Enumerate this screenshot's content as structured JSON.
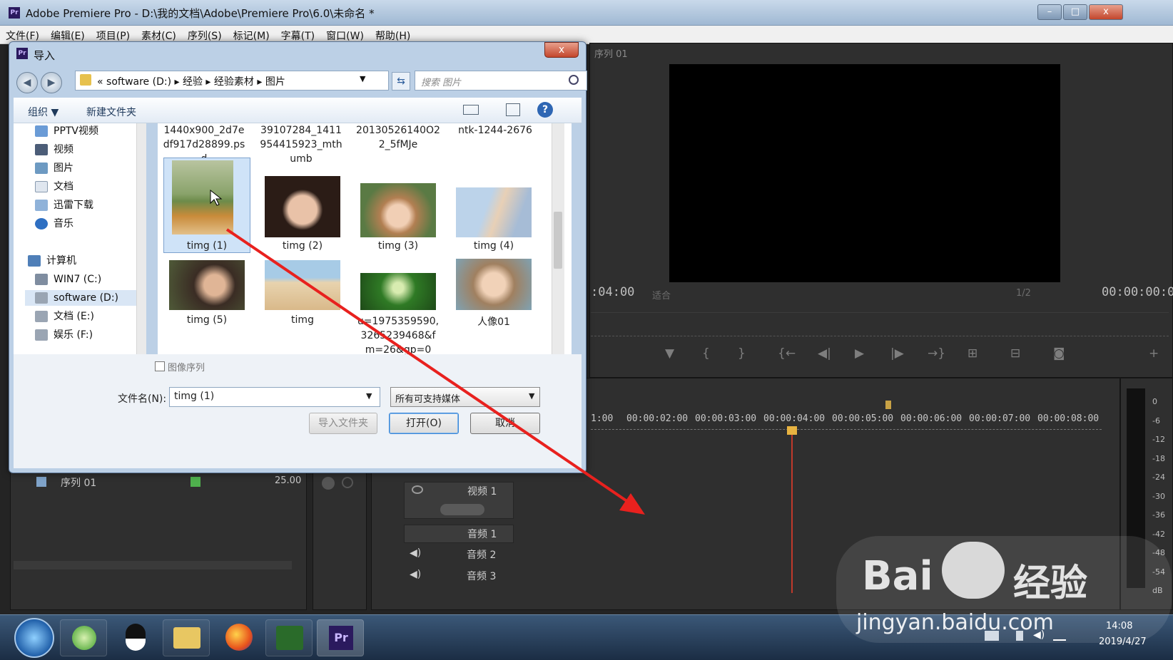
{
  "app": {
    "title": "Adobe Premiere Pro - D:\\我的文档\\Adobe\\Premiere Pro\\6.0\\未命名 *",
    "logo": "Pr",
    "controls": {
      "minimize": "–",
      "maximize": "□",
      "close": "x"
    }
  },
  "menu": [
    "文件(F)",
    "编辑(E)",
    "项目(P)",
    "素材(C)",
    "序列(S)",
    "标记(M)",
    "字幕(T)",
    "窗口(W)",
    "帮助(H)"
  ],
  "monitor": {
    "tab": "序列 01",
    "tc_left": ":04:00",
    "fit_label": "适合",
    "ratio": "1/2",
    "tc_right": "00:00:00:00",
    "controls": [
      "▼",
      "{",
      "}",
      "{←",
      "◀|",
      "▶",
      "|▶",
      "→}",
      "⊞",
      "⊟",
      "◙",
      "+"
    ]
  },
  "timeline": {
    "ruler": [
      "1:00",
      "00:00:02:00",
      "00:00:03:00",
      "00:00:04:00",
      "00:00:05:00",
      "00:00:06:00",
      "00:00:07:00",
      "00:00:08:00"
    ],
    "tracks": [
      "视频 1",
      "音频 1",
      "音频 2",
      "音频 3"
    ]
  },
  "project": {
    "item": "序列 01",
    "fps": "25.00"
  },
  "meter": [
    "0",
    "-6",
    "-12",
    "-18",
    "-24",
    "-30",
    "-36",
    "-42",
    "-48",
    "-54",
    "dB"
  ],
  "dialog": {
    "logo": "Pr",
    "title": "导入",
    "close": "x",
    "back": "◀",
    "forward": "▶",
    "path": [
      "«",
      "software (D:)",
      "经验",
      "经验素材",
      "图片"
    ],
    "search_placeholder": "搜索 图片",
    "toolbar": {
      "organize": "组织 ▼",
      "new_folder": "新建文件夹",
      "help": "?"
    },
    "nav": [
      {
        "label": "PPTV视频",
        "icon": "video-folder-icon"
      },
      {
        "label": "视频",
        "icon": "video-icon"
      },
      {
        "label": "图片",
        "icon": "picture-icon"
      },
      {
        "label": "文档",
        "icon": "document-icon"
      },
      {
        "label": "迅雷下载",
        "icon": "download-icon"
      },
      {
        "label": "音乐",
        "icon": "music-icon"
      },
      {
        "label": "计算机",
        "icon": "computer-icon"
      },
      {
        "label": "WIN7 (C:)",
        "icon": "drive-icon"
      },
      {
        "label": "software (D:)",
        "icon": "drive-icon"
      },
      {
        "label": "文档 (E:)",
        "icon": "drive-icon"
      },
      {
        "label": "娱乐 (F:)",
        "icon": "drive-icon"
      }
    ],
    "top_row": [
      [
        "1440x900_2d7e",
        "df917d28899.ps",
        "d"
      ],
      [
        "39107284_1411",
        "954415923_mth",
        "umb"
      ],
      [
        "20130526140O2",
        "2_5fMJe"
      ],
      [
        "ntk-1244-2676"
      ]
    ],
    "files": [
      [
        "timg (1)"
      ],
      [
        "timg (2)"
      ],
      [
        "timg (3)"
      ],
      [
        "timg (4)"
      ],
      [
        "timg (5)"
      ],
      [
        "timg"
      ],
      [
        "u=1975359590,",
        "3265239468&f",
        "m=26&gp=0"
      ],
      [
        "人像01"
      ]
    ],
    "image_sequence": "图像序列",
    "filename_label": "文件名(N):",
    "filename_value": "timg (1)",
    "filetype": "所有可支持媒体",
    "buttons": {
      "import_folder": "导入文件夹",
      "open": "打开(O)",
      "cancel": "取消"
    }
  },
  "taskbar": {
    "apps": [
      "start-orb",
      "browser-360",
      "qq",
      "file-explorer",
      "firefox",
      "video-player",
      "premiere"
    ],
    "premiere_label": "Pr",
    "time": "14:08",
    "date": "2019/4/27"
  },
  "watermark": {
    "brand": "Bai",
    "brand2": "经验",
    "url": "jingyan.baidu.com"
  },
  "colors": {
    "arrow": "#e8211e",
    "accent_blue": "#3a86d6",
    "green_swatch": "#4fb04d",
    "playhead": "#e8b341"
  }
}
